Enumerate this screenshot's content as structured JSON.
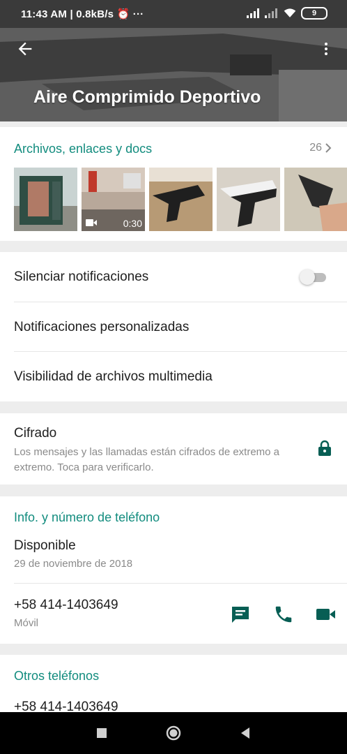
{
  "status_bar": {
    "time_text": "11:43 AM | 0.8kB/s",
    "battery_level": "9"
  },
  "header": {
    "title": "Aire Comprimido Deportivo"
  },
  "media": {
    "title": "Archivos, enlaces y docs",
    "count": "26",
    "video_duration": "0:30"
  },
  "settings": {
    "mute_label": "Silenciar notificaciones",
    "mute_enabled": false,
    "custom_notifications": "Notificaciones personalizadas",
    "media_visibility": "Visibilidad de archivos multimedia"
  },
  "encryption": {
    "title": "Cifrado",
    "description": "Los mensajes y las llamadas están cifrados de extremo a extremo. Toca para verificarlo."
  },
  "info": {
    "heading": "Info. y número de teléfono",
    "status": "Disponible",
    "status_date": "29 de noviembre de 2018",
    "phone": "+58 414-1403649",
    "phone_type": "Móvil"
  },
  "other_phones": {
    "heading": "Otros teléfonos",
    "phone": "+58 414-1403649"
  },
  "colors": {
    "accent": "#128c7e",
    "icon_green": "#075e54"
  }
}
